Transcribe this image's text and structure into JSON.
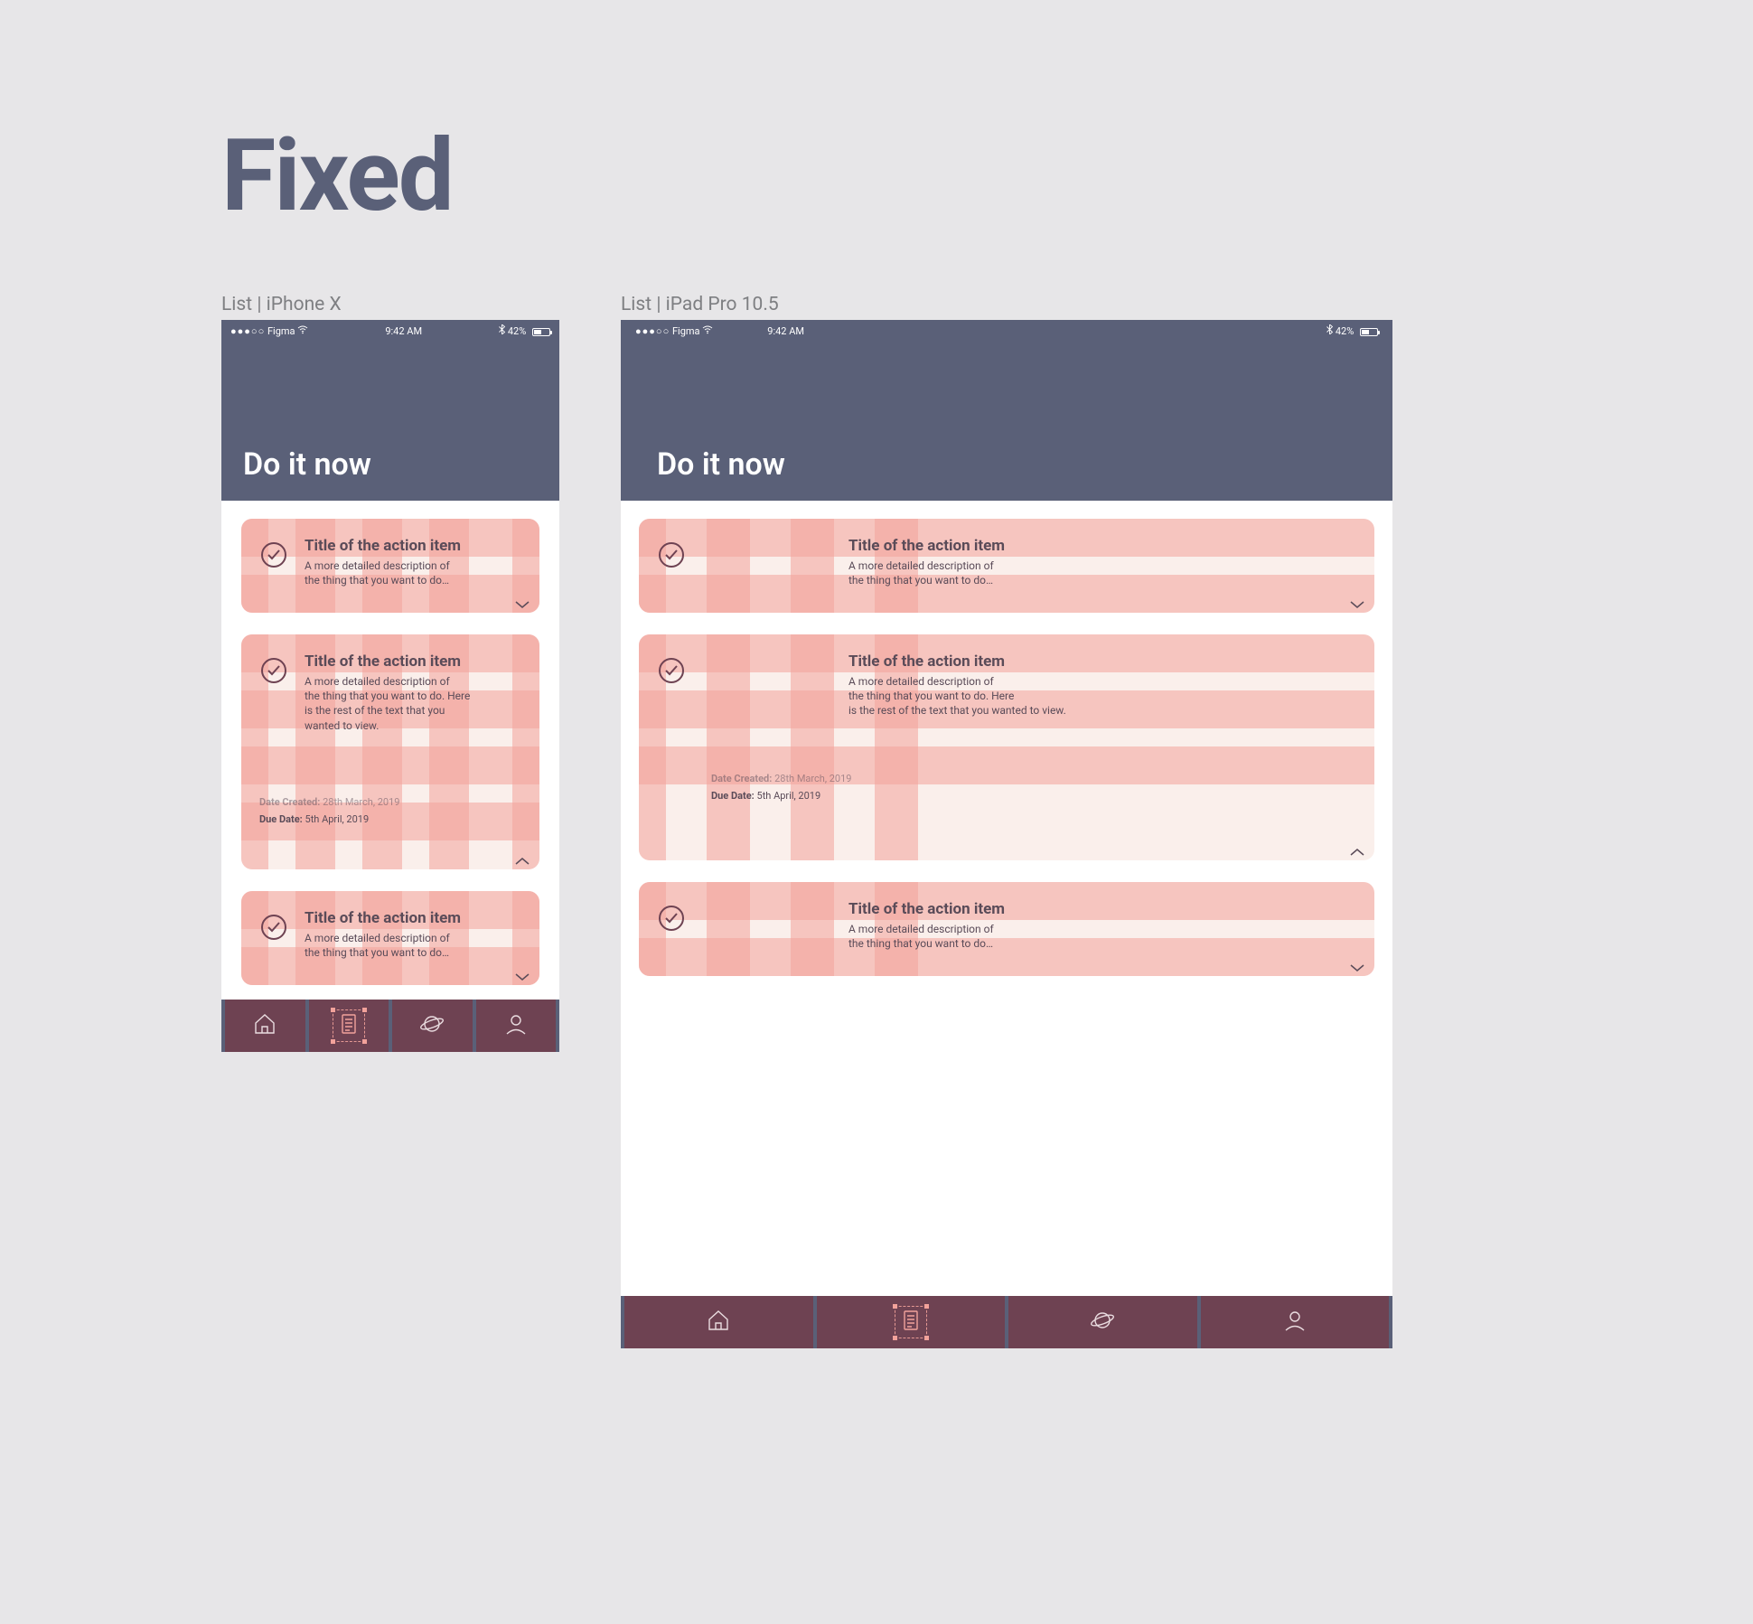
{
  "section_title": "Fixed",
  "frames": {
    "iphone": {
      "label": "List | iPhone X"
    },
    "ipad": {
      "label": "List | iPad Pro 10.5"
    }
  },
  "status": {
    "carrier_dots": "●●●○○",
    "carrier": "Figma",
    "wifi_icon": "wifi-icon",
    "time": "9:42 AM",
    "bt_icon": "bluetooth-icon",
    "battery_pct": "42%"
  },
  "header": {
    "title": "Do it now"
  },
  "items": [
    {
      "title": "Title of the action item",
      "desc_short": "A more detailed description of\nthe thing that you want to do…",
      "expanded": false
    },
    {
      "title": "Title of the action item",
      "desc_long": "A more detailed description of\nthe thing that you want to do. Here\nis the rest of the text that you\nwanted to view.",
      "desc_long_ipad": "A more detailed description of\nthe thing that you want to do. Here\nis the rest of the text that you wanted to view.",
      "created_label": "Date Created:",
      "created_value": "28th March, 2019",
      "due_label": "Due Date:",
      "due_value": "5th April, 2019",
      "expanded": true
    },
    {
      "title": "Title of the action item",
      "desc_short": "A more detailed description of\nthe thing that you want to do…",
      "expanded": false
    }
  ],
  "tabs": [
    {
      "name": "home",
      "active": false
    },
    {
      "name": "list",
      "active": true
    },
    {
      "name": "explore",
      "active": false
    },
    {
      "name": "profile",
      "active": false
    }
  ]
}
